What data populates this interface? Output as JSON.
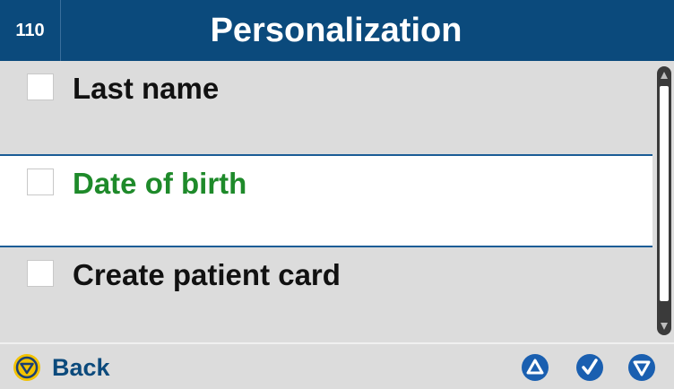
{
  "header": {
    "screen_number": "110",
    "title": "Personalization"
  },
  "list": {
    "items": [
      {
        "label": "Last name",
        "checked": false,
        "selected": false
      },
      {
        "label": "Date of birth",
        "checked": false,
        "selected": true
      },
      {
        "label": "Create patient card",
        "checked": false,
        "selected": false
      }
    ]
  },
  "footer": {
    "back_label": "Back",
    "back_icon": "stop-circle-icon",
    "up_icon": "up-arrow-icon",
    "confirm_icon": "checkmark-icon",
    "down_icon": "down-arrow-icon"
  },
  "colors": {
    "header_bg": "#0b4a7c",
    "selected_text": "#1e8a2a",
    "button_blue": "#1a5fb0",
    "back_yellow": "#f2c200"
  }
}
